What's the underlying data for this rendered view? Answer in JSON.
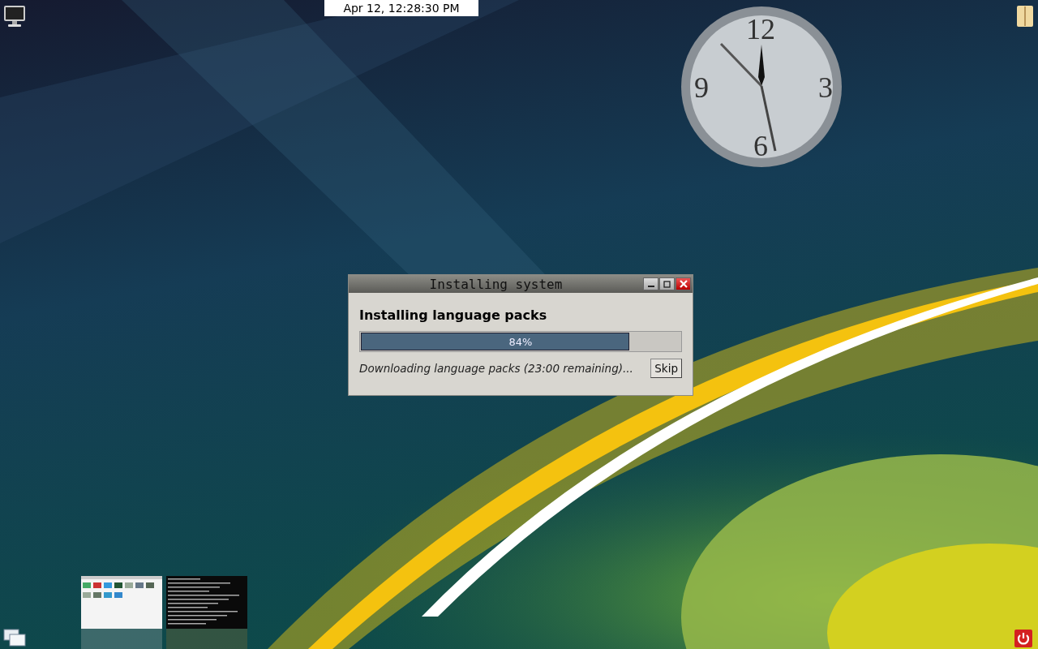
{
  "top_bar": {
    "datetime": "Apr 12, 12:28:30 PM"
  },
  "clock_widget": {
    "numerals": [
      "12",
      "3",
      "6",
      "9"
    ]
  },
  "dialog": {
    "title": "Installing system",
    "heading": "Installing language packs",
    "progress": {
      "level": 0.84,
      "label": "84%"
    },
    "status": "Downloading language packs (23:00 remaining)...",
    "button": "Skip"
  },
  "window_previews": [
    {
      "kind": "file-manager"
    },
    {
      "kind": "terminal"
    }
  ]
}
